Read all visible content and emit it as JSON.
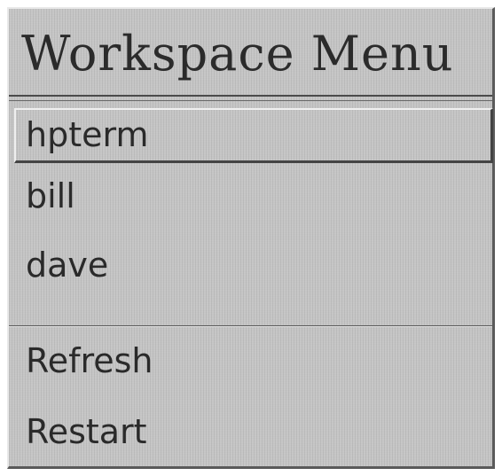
{
  "menu": {
    "title": "Workspace Menu",
    "items": [
      {
        "label": "hpterm",
        "selected": true
      },
      {
        "label": "bill"
      },
      {
        "label": "dave"
      }
    ],
    "actions": [
      {
        "label": "Refresh"
      },
      {
        "label": "Restart"
      }
    ]
  }
}
